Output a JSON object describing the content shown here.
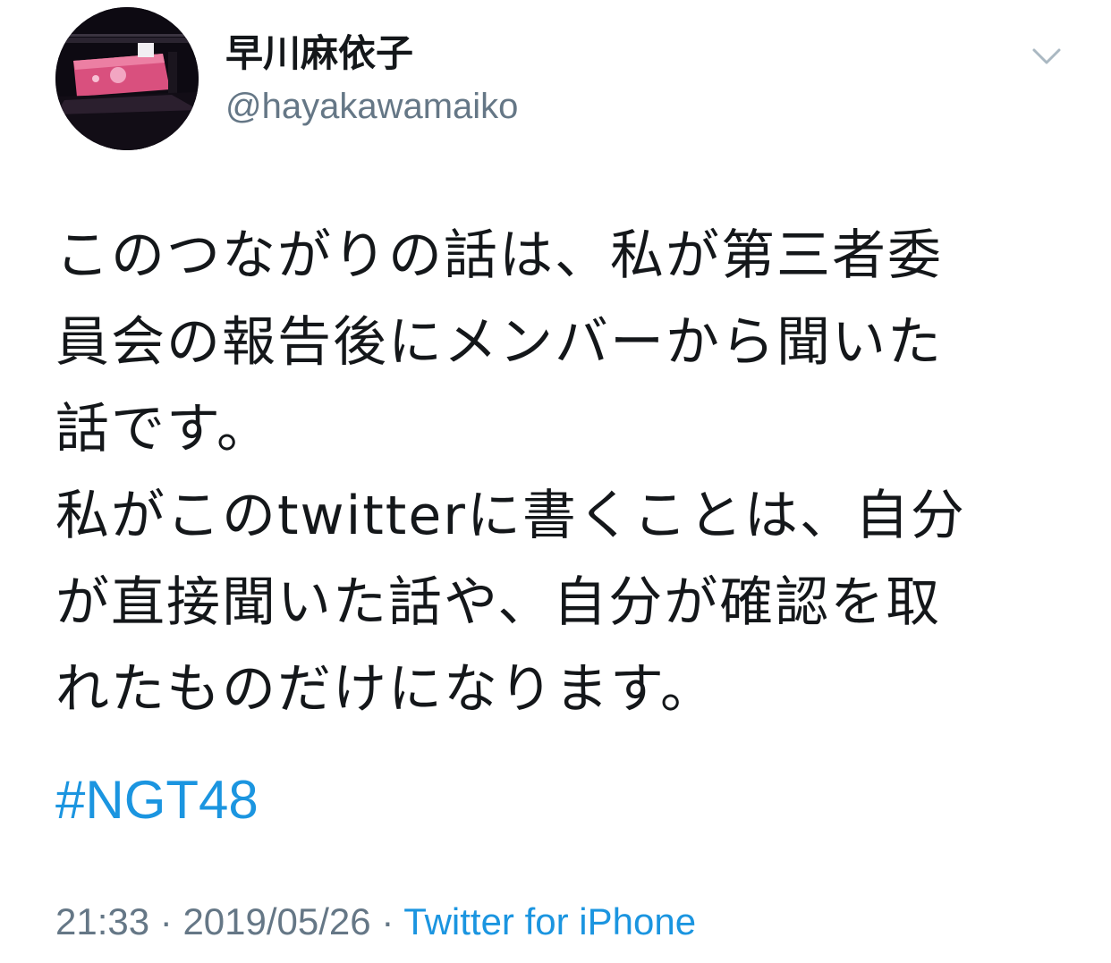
{
  "tweet": {
    "display_name": "早川麻依子",
    "handle": "@hayakawamaiko",
    "body_lines": [
      "このつながりの話は、私が第三者委",
      "員会の報告後にメンバーから聞いた",
      "話です。",
      "私がこのtwitterに書くことは、自分",
      "が直接聞いた話や、自分が確認を取",
      "れたものだけになります。"
    ],
    "hashtag": "#NGT48",
    "time": "21:33",
    "separator": " · ",
    "date": "2019/05/26",
    "source": "Twitter for iPhone",
    "icons": {
      "more": "chevron-down-icon"
    },
    "colors": {
      "link": "#1b95e0",
      "secondary": "#657786",
      "text": "#14171a"
    }
  }
}
